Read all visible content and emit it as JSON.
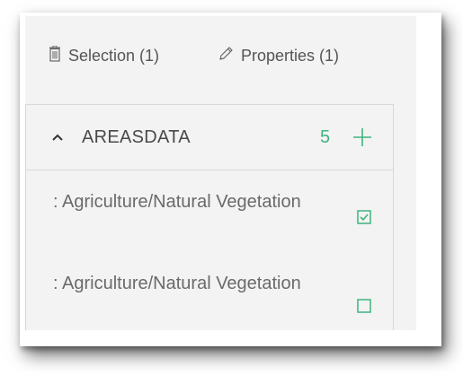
{
  "tabs": {
    "selection_label": "Selection (1)",
    "properties_label": "Properties (1)"
  },
  "layer": {
    "title": "AREASDATA",
    "count": "5"
  },
  "rows": [
    {
      "label": ": Agriculture/Natural Vegetation",
      "checked": true
    },
    {
      "label": ": Agriculture/Natural Vegetation",
      "checked": false
    }
  ],
  "colors": {
    "accent": "#3fb37f",
    "panel_bg": "#f3f3f3",
    "text": "#4a4a4a"
  },
  "icons": [
    "trash-icon",
    "pencil-icon",
    "chevron-up-icon",
    "plus-icon",
    "checkbox-checked-icon",
    "checkbox-empty-icon"
  ]
}
